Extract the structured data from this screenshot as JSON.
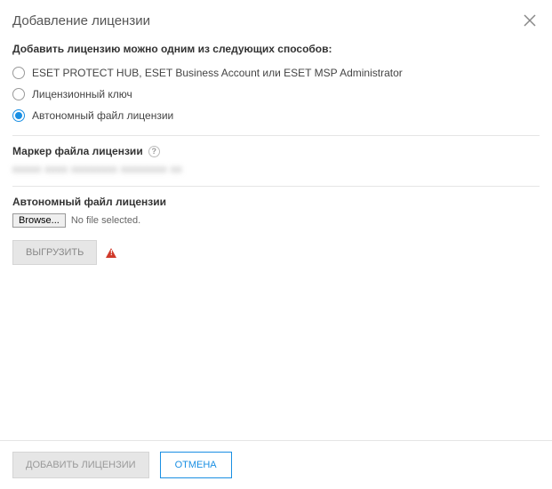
{
  "dialog": {
    "title": "Добавление лицензии"
  },
  "intro": "Добавить лицензию можно одним из следующих способов:",
  "options": [
    {
      "label": "ESET PROTECT HUB, ESET Business Account или ESET MSP Administrator",
      "selected": false
    },
    {
      "label": "Лицензионный ключ",
      "selected": false
    },
    {
      "label": "Автономный файл лицензии",
      "selected": true
    }
  ],
  "marker": {
    "label": "Маркер файла лицензии",
    "value": "xxxxx xxxx xxxxxxxx xxxxxxxx xx"
  },
  "offline_file": {
    "label": "Автономный файл лицензии",
    "browse_label": "Browse...",
    "file_status": "No file selected."
  },
  "upload": {
    "label": "ВЫГРУЗИТЬ"
  },
  "footer": {
    "add_label": "ДОБАВИТЬ ЛИЦЕНЗИИ",
    "cancel_label": "ОТМЕНА"
  },
  "icons": {
    "help_glyph": "?"
  }
}
